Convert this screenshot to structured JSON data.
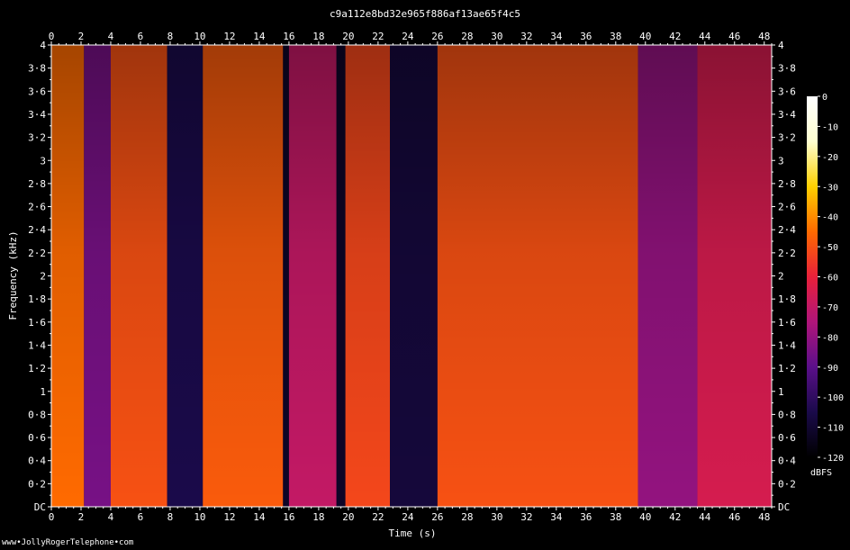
{
  "chart_data": {
    "type": "heatmap",
    "title": "c9a112e8bd32e965f886af13ae65f4c5",
    "xlabel": "Time (s)",
    "ylabel": "Frequency (kHz)",
    "xlim": [
      0,
      48.5
    ],
    "ylim": [
      0,
      4
    ],
    "x_ticks": [
      "0",
      "2",
      "4",
      "6",
      "8",
      "10",
      "12",
      "14",
      "16",
      "18",
      "20",
      "22",
      "24",
      "26",
      "28",
      "30",
      "32",
      "34",
      "36",
      "38",
      "40",
      "42",
      "44",
      "46",
      "48"
    ],
    "y_ticks": [
      "DC",
      "0·2",
      "0·4",
      "0·6",
      "0·8",
      "1",
      "1·2",
      "1·4",
      "1·6",
      "1·8",
      "2",
      "2·2",
      "2·4",
      "2·6",
      "2·8",
      "3",
      "3·2",
      "3·4",
      "3·6",
      "3·8",
      "4"
    ],
    "colorbar": {
      "label": "dBFS",
      "range": [
        -120,
        0
      ],
      "ticks": [
        "0",
        "-10",
        "-20",
        "-30",
        "-40",
        "-50",
        "-60",
        "-70",
        "-80",
        "-90",
        "-100",
        "-110",
        "-120"
      ],
      "colors": [
        "#000000",
        "#1a0a4a",
        "#5a0f8a",
        "#b0157a",
        "#e8203a",
        "#ff6a00",
        "#ffd000",
        "#ffffd0",
        "#ffffff"
      ]
    },
    "segments": [
      {
        "start": 0.0,
        "end": 2.2,
        "level": -45
      },
      {
        "start": 2.2,
        "end": 4.0,
        "level": -85
      },
      {
        "start": 4.0,
        "end": 7.8,
        "level": -50
      },
      {
        "start": 7.8,
        "end": 10.2,
        "level": -105
      },
      {
        "start": 10.2,
        "end": 15.6,
        "level": -48
      },
      {
        "start": 15.6,
        "end": 16.0,
        "level": -112
      },
      {
        "start": 16.0,
        "end": 19.2,
        "level": -70
      },
      {
        "start": 19.2,
        "end": 19.8,
        "level": -112
      },
      {
        "start": 19.8,
        "end": 22.8,
        "level": -52
      },
      {
        "start": 22.8,
        "end": 26.0,
        "level": -108
      },
      {
        "start": 26.0,
        "end": 39.5,
        "level": -50
      },
      {
        "start": 39.5,
        "end": 43.5,
        "level": -80
      },
      {
        "start": 43.5,
        "end": 48.5,
        "level": -65
      }
    ]
  },
  "footer_text": "www•JollyRogerTelephone•com"
}
